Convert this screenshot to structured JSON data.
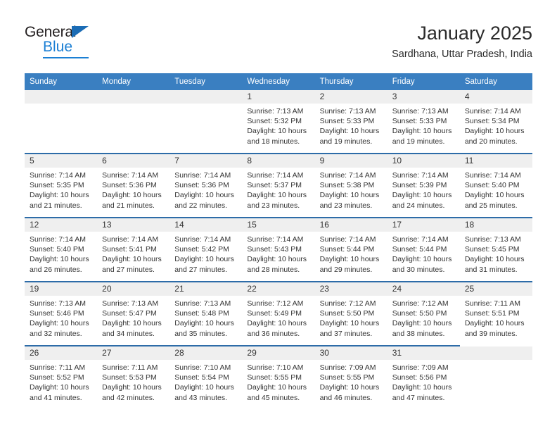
{
  "brand": {
    "name_top": "General",
    "name_bottom": "Blue",
    "accent_color": "#1b7fd4"
  },
  "header": {
    "title": "January 2025",
    "subtitle": "Sardhana, Uttar Pradesh, India",
    "header_bg_color": "#3a7fc1",
    "row_divider_color": "#2d6ca8",
    "daynum_bg_color": "#efefef"
  },
  "weekday_headers": [
    "Sunday",
    "Monday",
    "Tuesday",
    "Wednesday",
    "Thursday",
    "Friday",
    "Saturday"
  ],
  "labels": {
    "sunrise_prefix": "Sunrise:",
    "sunset_prefix": "Sunset:",
    "daylight_prefix": "Daylight:"
  },
  "weeks": [
    [
      {
        "day": "",
        "sunrise": "",
        "sunset": "",
        "daylight": "",
        "empty": true
      },
      {
        "day": "",
        "sunrise": "",
        "sunset": "",
        "daylight": "",
        "empty": true
      },
      {
        "day": "",
        "sunrise": "",
        "sunset": "",
        "daylight": "",
        "empty": true
      },
      {
        "day": "1",
        "sunrise": "Sunrise: 7:13 AM",
        "sunset": "Sunset: 5:32 PM",
        "daylight": "Daylight: 10 hours and 18 minutes."
      },
      {
        "day": "2",
        "sunrise": "Sunrise: 7:13 AM",
        "sunset": "Sunset: 5:33 PM",
        "daylight": "Daylight: 10 hours and 19 minutes."
      },
      {
        "day": "3",
        "sunrise": "Sunrise: 7:13 AM",
        "sunset": "Sunset: 5:33 PM",
        "daylight": "Daylight: 10 hours and 19 minutes."
      },
      {
        "day": "4",
        "sunrise": "Sunrise: 7:14 AM",
        "sunset": "Sunset: 5:34 PM",
        "daylight": "Daylight: 10 hours and 20 minutes."
      }
    ],
    [
      {
        "day": "5",
        "sunrise": "Sunrise: 7:14 AM",
        "sunset": "Sunset: 5:35 PM",
        "daylight": "Daylight: 10 hours and 21 minutes."
      },
      {
        "day": "6",
        "sunrise": "Sunrise: 7:14 AM",
        "sunset": "Sunset: 5:36 PM",
        "daylight": "Daylight: 10 hours and 21 minutes."
      },
      {
        "day": "7",
        "sunrise": "Sunrise: 7:14 AM",
        "sunset": "Sunset: 5:36 PM",
        "daylight": "Daylight: 10 hours and 22 minutes."
      },
      {
        "day": "8",
        "sunrise": "Sunrise: 7:14 AM",
        "sunset": "Sunset: 5:37 PM",
        "daylight": "Daylight: 10 hours and 23 minutes."
      },
      {
        "day": "9",
        "sunrise": "Sunrise: 7:14 AM",
        "sunset": "Sunset: 5:38 PM",
        "daylight": "Daylight: 10 hours and 23 minutes."
      },
      {
        "day": "10",
        "sunrise": "Sunrise: 7:14 AM",
        "sunset": "Sunset: 5:39 PM",
        "daylight": "Daylight: 10 hours and 24 minutes."
      },
      {
        "day": "11",
        "sunrise": "Sunrise: 7:14 AM",
        "sunset": "Sunset: 5:40 PM",
        "daylight": "Daylight: 10 hours and 25 minutes."
      }
    ],
    [
      {
        "day": "12",
        "sunrise": "Sunrise: 7:14 AM",
        "sunset": "Sunset: 5:40 PM",
        "daylight": "Daylight: 10 hours and 26 minutes."
      },
      {
        "day": "13",
        "sunrise": "Sunrise: 7:14 AM",
        "sunset": "Sunset: 5:41 PM",
        "daylight": "Daylight: 10 hours and 27 minutes."
      },
      {
        "day": "14",
        "sunrise": "Sunrise: 7:14 AM",
        "sunset": "Sunset: 5:42 PM",
        "daylight": "Daylight: 10 hours and 27 minutes."
      },
      {
        "day": "15",
        "sunrise": "Sunrise: 7:14 AM",
        "sunset": "Sunset: 5:43 PM",
        "daylight": "Daylight: 10 hours and 28 minutes."
      },
      {
        "day": "16",
        "sunrise": "Sunrise: 7:14 AM",
        "sunset": "Sunset: 5:44 PM",
        "daylight": "Daylight: 10 hours and 29 minutes."
      },
      {
        "day": "17",
        "sunrise": "Sunrise: 7:14 AM",
        "sunset": "Sunset: 5:44 PM",
        "daylight": "Daylight: 10 hours and 30 minutes."
      },
      {
        "day": "18",
        "sunrise": "Sunrise: 7:13 AM",
        "sunset": "Sunset: 5:45 PM",
        "daylight": "Daylight: 10 hours and 31 minutes."
      }
    ],
    [
      {
        "day": "19",
        "sunrise": "Sunrise: 7:13 AM",
        "sunset": "Sunset: 5:46 PM",
        "daylight": "Daylight: 10 hours and 32 minutes."
      },
      {
        "day": "20",
        "sunrise": "Sunrise: 7:13 AM",
        "sunset": "Sunset: 5:47 PM",
        "daylight": "Daylight: 10 hours and 34 minutes."
      },
      {
        "day": "21",
        "sunrise": "Sunrise: 7:13 AM",
        "sunset": "Sunset: 5:48 PM",
        "daylight": "Daylight: 10 hours and 35 minutes."
      },
      {
        "day": "22",
        "sunrise": "Sunrise: 7:12 AM",
        "sunset": "Sunset: 5:49 PM",
        "daylight": "Daylight: 10 hours and 36 minutes."
      },
      {
        "day": "23",
        "sunrise": "Sunrise: 7:12 AM",
        "sunset": "Sunset: 5:50 PM",
        "daylight": "Daylight: 10 hours and 37 minutes."
      },
      {
        "day": "24",
        "sunrise": "Sunrise: 7:12 AM",
        "sunset": "Sunset: 5:50 PM",
        "daylight": "Daylight: 10 hours and 38 minutes."
      },
      {
        "day": "25",
        "sunrise": "Sunrise: 7:11 AM",
        "sunset": "Sunset: 5:51 PM",
        "daylight": "Daylight: 10 hours and 39 minutes."
      }
    ],
    [
      {
        "day": "26",
        "sunrise": "Sunrise: 7:11 AM",
        "sunset": "Sunset: 5:52 PM",
        "daylight": "Daylight: 10 hours and 41 minutes."
      },
      {
        "day": "27",
        "sunrise": "Sunrise: 7:11 AM",
        "sunset": "Sunset: 5:53 PM",
        "daylight": "Daylight: 10 hours and 42 minutes."
      },
      {
        "day": "28",
        "sunrise": "Sunrise: 7:10 AM",
        "sunset": "Sunset: 5:54 PM",
        "daylight": "Daylight: 10 hours and 43 minutes."
      },
      {
        "day": "29",
        "sunrise": "Sunrise: 7:10 AM",
        "sunset": "Sunset: 5:55 PM",
        "daylight": "Daylight: 10 hours and 45 minutes."
      },
      {
        "day": "30",
        "sunrise": "Sunrise: 7:09 AM",
        "sunset": "Sunset: 5:55 PM",
        "daylight": "Daylight: 10 hours and 46 minutes."
      },
      {
        "day": "31",
        "sunrise": "Sunrise: 7:09 AM",
        "sunset": "Sunset: 5:56 PM",
        "daylight": "Daylight: 10 hours and 47 minutes."
      },
      {
        "day": "",
        "sunrise": "",
        "sunset": "",
        "daylight": "",
        "empty": true,
        "no_band": true
      }
    ]
  ]
}
